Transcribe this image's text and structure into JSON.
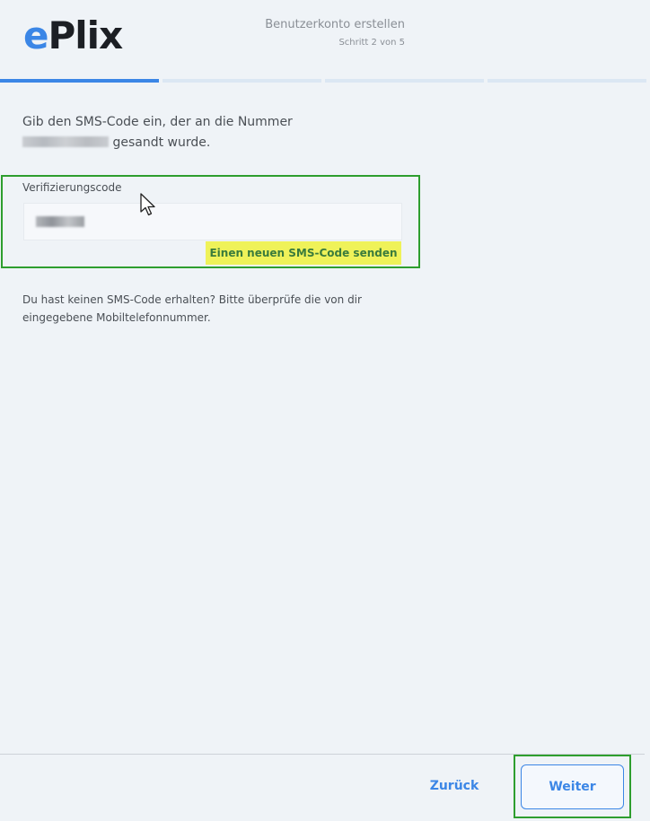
{
  "logo": {
    "prefix": "e",
    "rest": "Plix"
  },
  "header": {
    "title": "Benutzerkonto erstellen",
    "step": "Schritt 2 von 5"
  },
  "progress": {
    "current_step": 2,
    "total_steps": 5,
    "segments_shown": 4
  },
  "instruction": {
    "before": "Gib den SMS-Code ein, der an die Nummer",
    "after": "gesandt wurde."
  },
  "code_field": {
    "label": "Verifizierungscode"
  },
  "resend_label": "Einen neuen SMS-Code senden",
  "hint": "Du hast keinen SMS-Code erhalten? Bitte überprüfe die von dir eingegebene Mobiltelefonnummer.",
  "footer": {
    "back_label": "Zurück",
    "next_label": "Weiter"
  },
  "colors": {
    "accent": "#3b86e6",
    "highlight": "#eff259",
    "annotation_border": "#2e9e2e",
    "background": "#eff3f7"
  }
}
